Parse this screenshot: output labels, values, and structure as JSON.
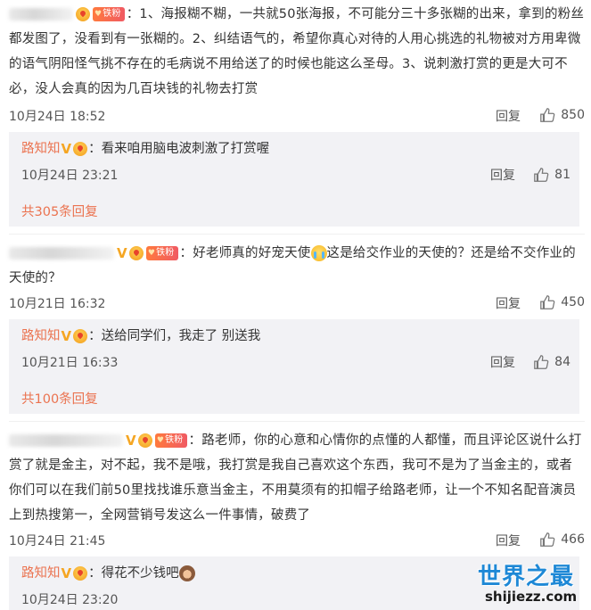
{
  "comments": [
    {
      "text": "：1、海报糊不糊，一共就50张海报，不可能分三十多张糊的出来，拿到的粉丝都发图了，没看到有一张糊的。2、纠结语气的，希望你真心对待的人用心挑选的礼物被对方用卑微的语气阴阳怪气挑不存在的毛病说不用给送了的时候也能这么圣母。3、说刺激打赏的更是大可不必，没人会真的因为几百块钱的礼物去打赏",
      "fan_badge": "铁粉",
      "date": "10月24日 18:52",
      "reply_label": "回复",
      "likes": "850",
      "reply": {
        "user": "路知知",
        "text": "：看来咱用脑电波刺激了打赏喔",
        "date": "10月24日 23:21",
        "reply_label": "回复",
        "likes": "81"
      },
      "more_replies": "共305条回复"
    },
    {
      "text_before_emoji": "：好老师真的好宠天使",
      "text_after_emoji": "这是给交作业的天使的？还是给不交作业的天使的？",
      "fan_badge": "铁粉",
      "date": "10月21日 16:32",
      "reply_label": "回复",
      "likes": "450",
      "reply": {
        "user": "路知知",
        "text": "：送给同学们，我走了 别送我",
        "date": "10月21日 16:33",
        "reply_label": "回复",
        "likes": "84"
      },
      "more_replies": "共100条回复"
    },
    {
      "text": "：路老师，你的心意和心情你的点懂的人都懂，而且评论区说什么打赏了就是金主，对不起，我不是哦，我打赏是我自己喜欢这个东西，我可不是为了当金主的，或者你们可以在我们前50里找找谁乐意当金主，不用莫须有的扣帽子给路老师，让一个不知名配音演员上到热搜第一，全网营销号发这么一件事情，破费了",
      "fan_badge": "铁粉",
      "date": "10月24日 21:45",
      "reply_label": "回复",
      "likes": "466",
      "reply": {
        "user": "路知知",
        "text": "：得花不少钱吧",
        "date": "10月24日 23:20"
      }
    }
  ],
  "watermark": {
    "title": "世界之最",
    "url": "shijiezz.com"
  },
  "colors": {
    "username": "#eb7350",
    "reply_box": "#f2f2f5",
    "watermark_blue": "#1e88d6"
  },
  "icons": [
    "thumbs-up-icon",
    "vip-v-icon",
    "fan-medal-icon",
    "crying-face-emoji",
    "monkey-emoji"
  ]
}
